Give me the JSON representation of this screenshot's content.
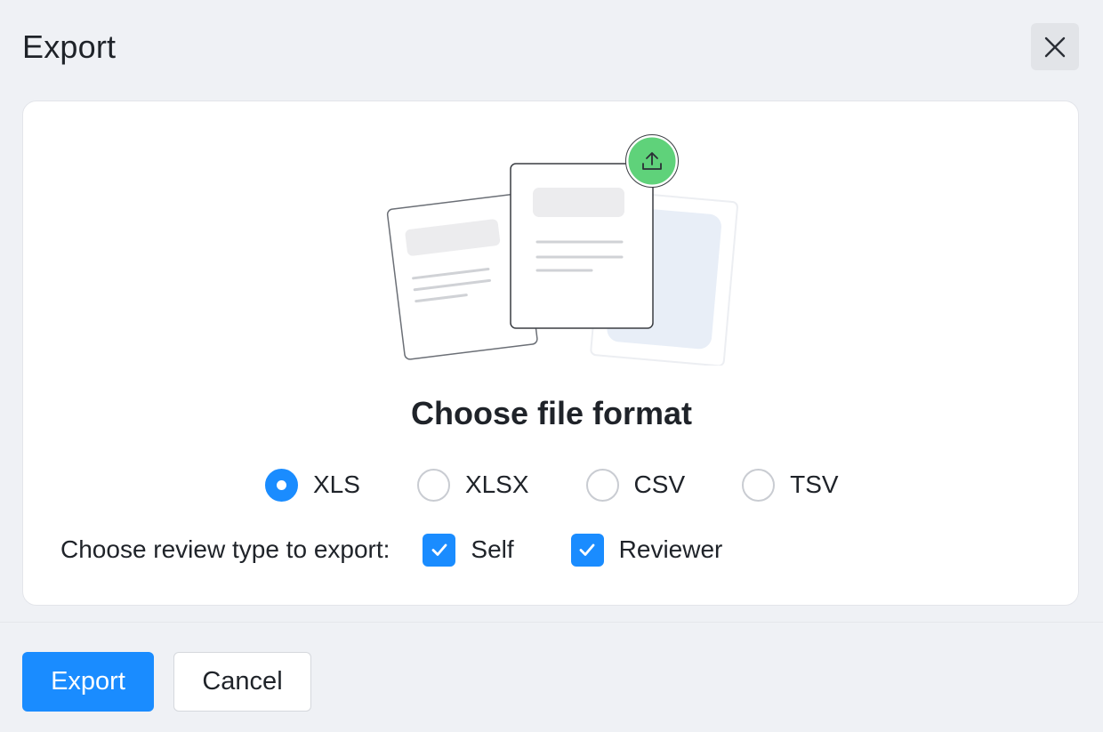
{
  "dialog": {
    "title": "Export",
    "close_icon": "close-icon"
  },
  "illustration": {
    "icon": "upload-icon",
    "accent_color": "#5fd27a"
  },
  "format_section": {
    "title": "Choose file format",
    "options": [
      {
        "label": "XLS",
        "selected": true
      },
      {
        "label": "XLSX",
        "selected": false
      },
      {
        "label": "CSV",
        "selected": false
      },
      {
        "label": "TSV",
        "selected": false
      }
    ]
  },
  "review_section": {
    "label": "Choose review type to export:",
    "options": [
      {
        "label": "Self",
        "checked": true
      },
      {
        "label": "Reviewer",
        "checked": true
      }
    ]
  },
  "footer": {
    "export_label": "Export",
    "cancel_label": "Cancel"
  },
  "colors": {
    "primary": "#1a8cff",
    "background": "#eff1f5",
    "card": "#ffffff",
    "text": "#1f2329"
  }
}
